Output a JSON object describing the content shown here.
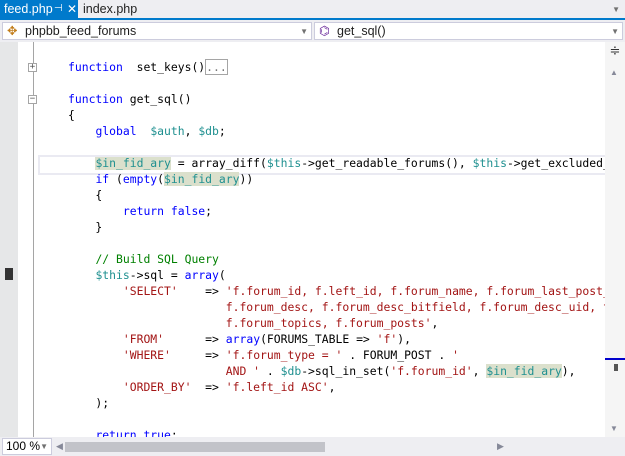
{
  "tabs": [
    {
      "label": "feed.php",
      "active": true
    },
    {
      "label": "index.php",
      "active": false
    }
  ],
  "icons": {
    "pin": "pin-icon",
    "close": "close-icon",
    "class": "class-icon",
    "method": "method-icon",
    "split": "splitter-icon"
  },
  "navbar": {
    "class_dropdown": "phpbb_feed_forums",
    "member_dropdown": "get_sql()"
  },
  "zoom_level": "100 %",
  "colors": {
    "accent": "#007acc",
    "keyword": "#0000ff",
    "variable": "#1f9090",
    "string": "#a31515",
    "comment": "#008000"
  },
  "code_lines": [
    [
      [
        "kw",
        "function"
      ],
      [
        "",
        "  set_keys()"
      ],
      [
        "collapsed",
        "..."
      ]
    ],
    [],
    [
      [
        "kw",
        "function"
      ],
      [
        "",
        " get_sql()"
      ]
    ],
    [
      [
        "",
        "{"
      ]
    ],
    [
      [
        "",
        "    "
      ],
      [
        "kw",
        "global"
      ],
      [
        "",
        "  "
      ],
      [
        "var",
        "$auth"
      ],
      [
        "",
        ", "
      ],
      [
        "var",
        "$db"
      ],
      [
        "",
        ";"
      ]
    ],
    [],
    [
      [
        "",
        "    "
      ],
      [
        "var hl",
        "$in_fid_ary"
      ],
      [
        "",
        " = array_diff("
      ],
      [
        "var",
        "$this"
      ],
      [
        "",
        "->get_readable_forums(), "
      ],
      [
        "var",
        "$this"
      ],
      [
        "",
        "->get_excluded_forums());"
      ]
    ],
    [
      [
        "",
        "    "
      ],
      [
        "kw",
        "if"
      ],
      [
        "",
        " ("
      ],
      [
        "kw",
        "empty"
      ],
      [
        "",
        "("
      ],
      [
        "var hl",
        "$in_fid_ary"
      ],
      [
        "",
        "))"
      ]
    ],
    [
      [
        "",
        "    {"
      ]
    ],
    [
      [
        "",
        "        "
      ],
      [
        "kw",
        "return false"
      ],
      [
        "",
        ";"
      ]
    ],
    [
      [
        "",
        "    }"
      ]
    ],
    [],
    [
      [
        "",
        "    "
      ],
      [
        "cm",
        "// Build SQL Query"
      ]
    ],
    [
      [
        "",
        "    "
      ],
      [
        "var",
        "$this"
      ],
      [
        "",
        "->sql = "
      ],
      [
        "kw",
        "array"
      ],
      [
        "",
        "("
      ]
    ],
    [
      [
        "",
        "        "
      ],
      [
        "str",
        "'SELECT'"
      ],
      [
        "",
        "    => "
      ],
      [
        "str",
        "'f.forum_id, f.left_id, f.forum_name, f.forum_last_post_time,"
      ]
    ],
    [
      [
        "",
        "                       "
      ],
      [
        "str",
        "f.forum_desc, f.forum_desc_bitfield, f.forum_desc_uid, f.forum_desc_options,"
      ]
    ],
    [
      [
        "",
        "                       "
      ],
      [
        "str",
        "f.forum_topics, f.forum_posts'"
      ],
      [
        "",
        ","
      ]
    ],
    [
      [
        "",
        "        "
      ],
      [
        "str",
        "'FROM'"
      ],
      [
        "",
        "      => "
      ],
      [
        "kw",
        "array"
      ],
      [
        "",
        "(FORUMS_TABLE => "
      ],
      [
        "str",
        "'f'"
      ],
      [
        "",
        "),"
      ]
    ],
    [
      [
        "",
        "        "
      ],
      [
        "str",
        "'WHERE'"
      ],
      [
        "",
        "     => "
      ],
      [
        "str",
        "'f.forum_type = '"
      ],
      [
        "",
        " . FORUM_POST . "
      ],
      [
        "str",
        "'"
      ]
    ],
    [
      [
        "",
        "                       "
      ],
      [
        "str",
        "AND '"
      ],
      [
        "",
        " . "
      ],
      [
        "var",
        "$db"
      ],
      [
        "",
        "->sql_in_set("
      ],
      [
        "str",
        "'f.forum_id'"
      ],
      [
        "",
        ", "
      ],
      [
        "var hl",
        "$in_fid_ary"
      ],
      [
        "",
        "),"
      ]
    ],
    [
      [
        "",
        "        "
      ],
      [
        "str",
        "'ORDER_BY'"
      ],
      [
        "",
        "  => "
      ],
      [
        "str",
        "'f.left_id ASC'"
      ],
      [
        "",
        ","
      ]
    ],
    [
      [
        "",
        "    );"
      ]
    ],
    [],
    [
      [
        "",
        "    "
      ],
      [
        "kw",
        "return true"
      ],
      [
        "",
        ";"
      ]
    ]
  ]
}
